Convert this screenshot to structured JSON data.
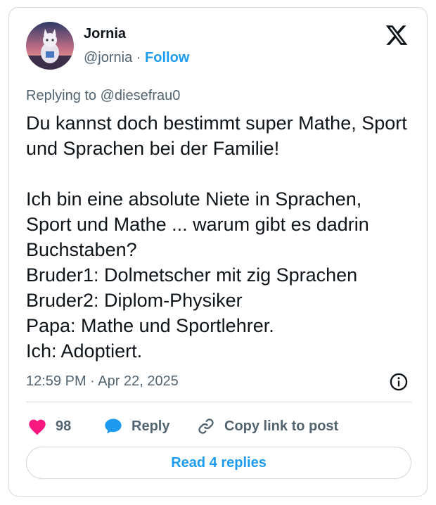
{
  "author": {
    "name": "Jornia",
    "handle": "@jornia",
    "separator": "·",
    "follow_label": "Follow"
  },
  "icons": {
    "logo": "x-logo-icon",
    "info": "info-icon",
    "like": "heart-icon",
    "reply": "speech-bubble-icon",
    "copy_link": "link-icon"
  },
  "colors": {
    "accent": "#1d9bf0",
    "like": "#f91880",
    "muted_text": "#536471",
    "border": "#cfd9de"
  },
  "tweet": {
    "replying_prefix": "Replying to ",
    "replying_handle": "@diesefrau0",
    "text": "Du kannst doch bestimmt super Mathe, Sport und Sprachen bei der Familie!\n\nIch bin eine absolute Niete in Sprachen, Sport und Mathe ... warum gibt es dadrin Buchstaben?\nBruder1: Dolmetscher mit zig Sprachen\nBruder2: Diplom-Physiker\nPapa: Mathe und Sportlehrer.\nIch: Adoptiert.",
    "timestamp": "12:59 PM · Apr 22, 2025"
  },
  "actions": {
    "like_count": "98",
    "reply_label": "Reply",
    "copy_link_label": "Copy link to post"
  },
  "footer": {
    "read_replies_label": "Read 4 replies"
  }
}
